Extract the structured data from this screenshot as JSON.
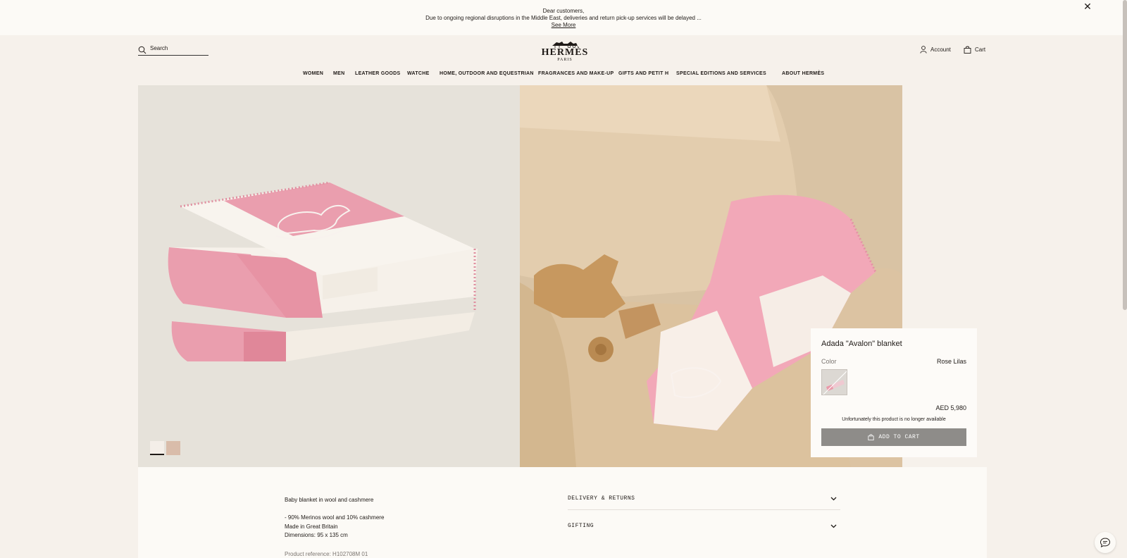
{
  "banner": {
    "line1": "Dear customers,",
    "line2": "Due to ongoing regional disruptions in the Middle East, deliveries and return pick-up services will be delayed ...",
    "see_more": "See More",
    "close_icon": "close-icon"
  },
  "header": {
    "search_placeholder": "Search",
    "logo_name": "HERMÈS",
    "logo_city": "PARIS",
    "account": "Account",
    "cart": "Cart"
  },
  "nav": {
    "items": [
      "WOMEN",
      "MEN",
      "LEATHER GOODS",
      "WATCHE",
      "HOME, OUTDOOR AND EQUESTRIAN",
      "FRAGRANCES AND MAKE-UP",
      "GIFTS AND PETIT H",
      "SPECIAL EDITIONS AND SERVICES",
      "ABOUT HERMÈS"
    ]
  },
  "product": {
    "title": "Adada \"Avalon\" blanket",
    "color_label": "Color",
    "color_value": "Rose Lilas",
    "price": "AED 5,980",
    "unavailable": "Unfortunately this product is no longer available",
    "add_to_cart": "ADD TO CART"
  },
  "details": {
    "title": "Baby blanket in wool and cashmere",
    "line1": "- 90% Merinos wool and 10% cashmere",
    "line2": "Made in Great Britain",
    "line3": "Dimensions: 95 x 135 cm",
    "reference": "Product reference:  H102708M 01",
    "accordion": [
      "DELIVERY & RETURNS",
      "GIFTING"
    ]
  },
  "colors": {
    "background": "#f6f1eb",
    "banner": "#fcfaf6",
    "button_disabled": "#8e8c89",
    "blanket_pink": "#e99aaa"
  }
}
